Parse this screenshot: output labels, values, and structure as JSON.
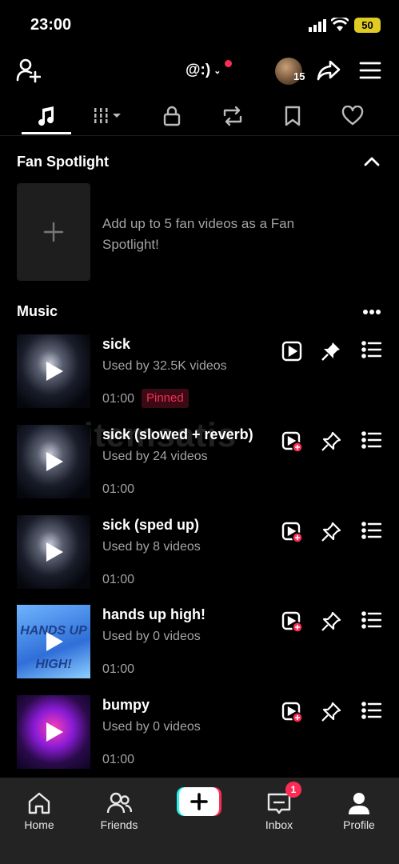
{
  "status_bar": {
    "time": "23:00",
    "battery": "50"
  },
  "header": {
    "handle": "@:)",
    "avatar_count": "15",
    "icons": [
      "add-user-icon",
      "share-icon",
      "menu-icon"
    ]
  },
  "tabs": [
    "music-note-icon",
    "grid-icon",
    "lock-icon",
    "repost-icon",
    "bookmark-icon",
    "heart-icon"
  ],
  "fan_spotlight": {
    "title": "Fan Spotlight",
    "description": "Add up to 5 fan videos as a Fan Spotlight!"
  },
  "music": {
    "title": "Music",
    "tracks": [
      {
        "title": "sick",
        "used": "Used by 32.5K videos",
        "duration": "01:00",
        "badge": "Pinned"
      },
      {
        "title": "sick (slowed + reverb)",
        "used": "Used by 24 videos",
        "duration": "01:00"
      },
      {
        "title": "sick (sped up)",
        "used": "Used by 8 videos",
        "duration": "01:00"
      },
      {
        "title": "hands up high!",
        "used": "Used by 0 videos",
        "duration": "01:00",
        "cover_text": "HANDS UP HIGH!"
      },
      {
        "title": "bumpy",
        "used": "Used by 0 videos",
        "duration": "01:00"
      }
    ]
  },
  "watermark": "itemsatis",
  "bottom_nav": {
    "home": "Home",
    "friends": "Friends",
    "inbox": "Inbox",
    "inbox_badge": "1",
    "profile": "Profile"
  },
  "colors": {
    "accent": "#fe2c55",
    "background": "#000000",
    "nav_bg": "#232323",
    "secondary_text": "#a3a3a3"
  }
}
